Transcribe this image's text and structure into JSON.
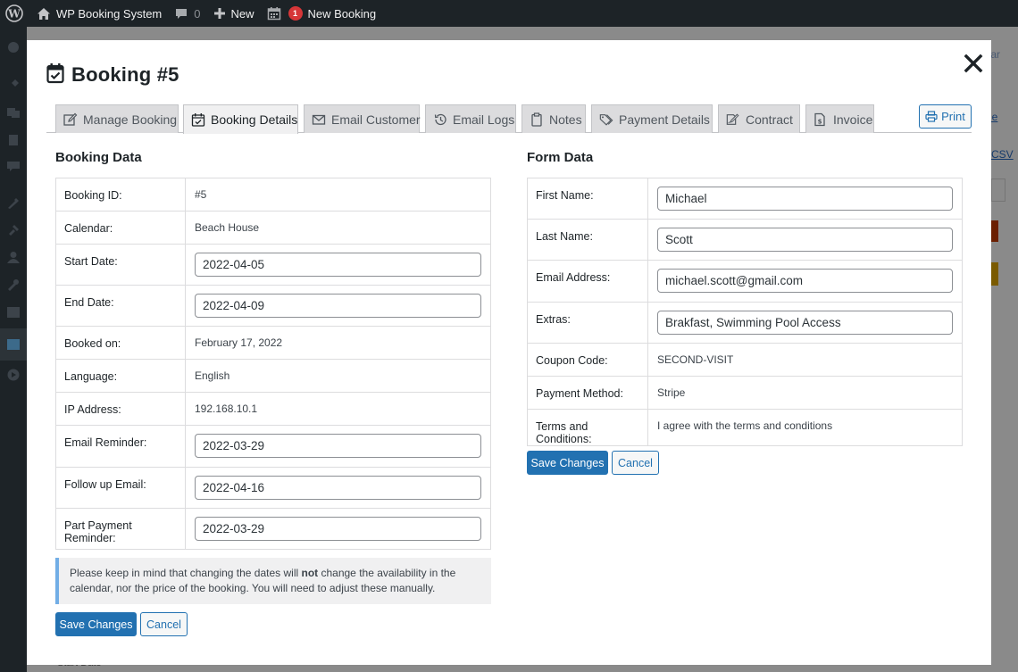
{
  "admin_bar": {
    "site_name": "WP Booking System",
    "comments_count": "0",
    "new_label": "New",
    "notif_count": "1",
    "new_booking_label": "New Booking"
  },
  "background": {
    "partial_link_1": "ndar",
    "partial_link_2": "itle",
    "partial_link_3": "CSV",
    "partial_text_bottom": "Start Date"
  },
  "modal": {
    "title": "Booking #5",
    "tabs": [
      {
        "label": "Manage Booking",
        "icon": "pencil-icon"
      },
      {
        "label": "Booking Details",
        "icon": "calendar-check-icon",
        "active": true
      },
      {
        "label": "Email Customer",
        "icon": "envelope-icon"
      },
      {
        "label": "Email Logs",
        "icon": "history-icon"
      },
      {
        "label": "Notes",
        "icon": "clipboard-icon"
      },
      {
        "label": "Payment Details",
        "icon": "tags-icon"
      },
      {
        "label": "Contract",
        "icon": "signature-icon"
      },
      {
        "label": "Invoice",
        "icon": "invoice-icon"
      }
    ],
    "print_label": "Print"
  },
  "booking_data": {
    "heading": "Booking Data",
    "rows": [
      {
        "label": "Booking ID:",
        "value": "#5"
      },
      {
        "label": "Calendar:",
        "value": "Beach House"
      },
      {
        "label": "Start Date:",
        "value": "2022-04-05"
      },
      {
        "label": "End Date:",
        "value": "2022-04-09"
      },
      {
        "label": "Booked on:",
        "value": "February 17, 2022"
      },
      {
        "label": "Language:",
        "value": "English"
      },
      {
        "label": "IP Address:",
        "value": "192.168.10.1"
      },
      {
        "label": "Email Reminder:",
        "value": "2022-03-29"
      },
      {
        "label": "Follow up Email:",
        "value": "2022-04-16"
      },
      {
        "label": "Part Payment Reminder:",
        "value": "2022-03-29"
      }
    ],
    "notice_before": "Please keep in mind that changing the dates will ",
    "notice_bold": "not",
    "notice_after": " change the availability in the calendar, nor the price of the booking. You will need to adjust these manually.",
    "save_label": "Save Changes",
    "cancel_label": "Cancel"
  },
  "form_data": {
    "heading": "Form Data",
    "rows": [
      {
        "label": "First Name:",
        "value": "Michael"
      },
      {
        "label": "Last Name:",
        "value": "Scott"
      },
      {
        "label": "Email Address:",
        "value": "michael.scott@gmail.com"
      },
      {
        "label": "Extras:",
        "value": "Brakfast, Swimming Pool Access"
      },
      {
        "label": "Coupon Code:",
        "value": "SECOND-VISIT"
      },
      {
        "label": "Payment Method:",
        "value": "Stripe"
      },
      {
        "label": "Terms and Conditions:",
        "value": "I agree with the terms and conditions"
      }
    ],
    "save_label": "Save Changes",
    "cancel_label": "Cancel"
  },
  "colors": {
    "admin_bar": "#1d2327",
    "primary": "#2271b1",
    "notif_badge": "#d63638",
    "notice_border": "#72aee6"
  }
}
